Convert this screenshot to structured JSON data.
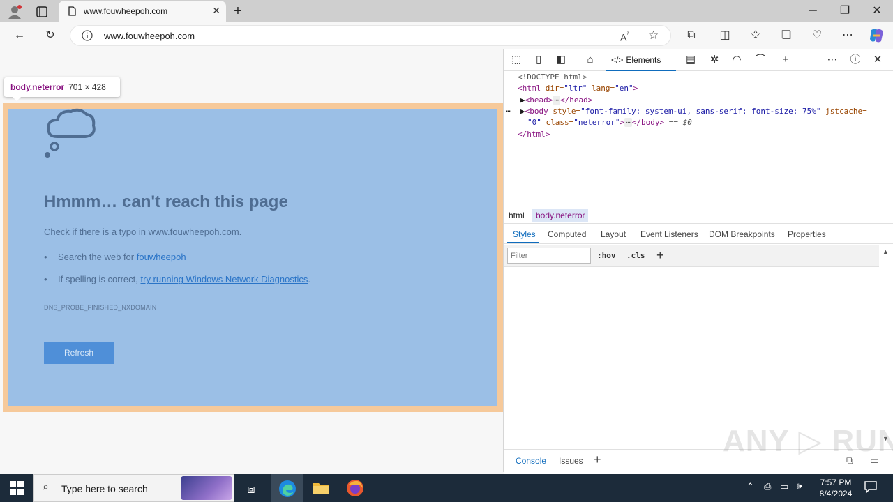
{
  "browser": {
    "tab_title": "www.fouwheepoh.com",
    "url": "www.fouwheepoh.com",
    "new_tab_label": "+"
  },
  "page": {
    "inspect_tooltip": {
      "selector": "body.neterror",
      "size": "701 × 428"
    },
    "error_title": "Hmmm… can't reach this page",
    "check_prefix": "Check if there is a typo in ",
    "check_domain": "www.fouwheepoh.com",
    "check_suffix": ".",
    "bullet1_prefix": "Search the web for ",
    "bullet1_link": "fouwheepoh",
    "bullet2_prefix": "If spelling is correct, ",
    "bullet2_link": "try running Windows Network Diagnostics",
    "bullet2_suffix": ".",
    "error_code": "DNS_PROBE_FINISHED_NXDOMAIN",
    "refresh_label": "Refresh"
  },
  "devtools": {
    "elements_tab": "Elements",
    "dom": {
      "doctype": "<!DOCTYPE html>",
      "html_open_tag": "<html",
      "html_attr_dir": " dir=",
      "html_dir_val": "\"ltr\"",
      "html_attr_lang": " lang=",
      "html_lang_val": "\"en\"",
      "html_open_close": ">",
      "head_open": "<head>",
      "ellipsis": "⋯",
      "head_close": "</head>",
      "body_open_tag": "<body",
      "body_attr_style": " style=",
      "body_style_val": "\"font-family: system-ui, sans-serif; font-size: 75%\"",
      "body_attr_jstcache": " jstcache=",
      "body_jstcache_val": "\"0\"",
      "body_attr_class": " class=",
      "body_class_val": "\"neterror\"",
      "body_open_close": ">",
      "body_close": "</body>",
      "selected_marker": " == $0",
      "html_close": "</html>"
    },
    "breadcrumbs": [
      "html",
      "body.neterror"
    ],
    "subtabs": [
      "Styles",
      "Computed",
      "Layout",
      "Event Listeners",
      "DOM Breakpoints",
      "Properties"
    ],
    "filter_placeholder": "Filter",
    "hov_label": ":hov",
    "cls_label": ".cls",
    "drawer_tabs": [
      "Console",
      "Issues"
    ]
  },
  "watermark": "ANY ▷ RUN",
  "taskbar": {
    "search_placeholder": "Type here to search",
    "time": "7:57 PM",
    "date": "8/4/2024"
  },
  "colors": {
    "body_highlight_margin": "#f6c99a",
    "body_highlight_content": "#9bbfe6",
    "accent": "#0f6cbd",
    "taskbar": "#1c2b3a"
  }
}
